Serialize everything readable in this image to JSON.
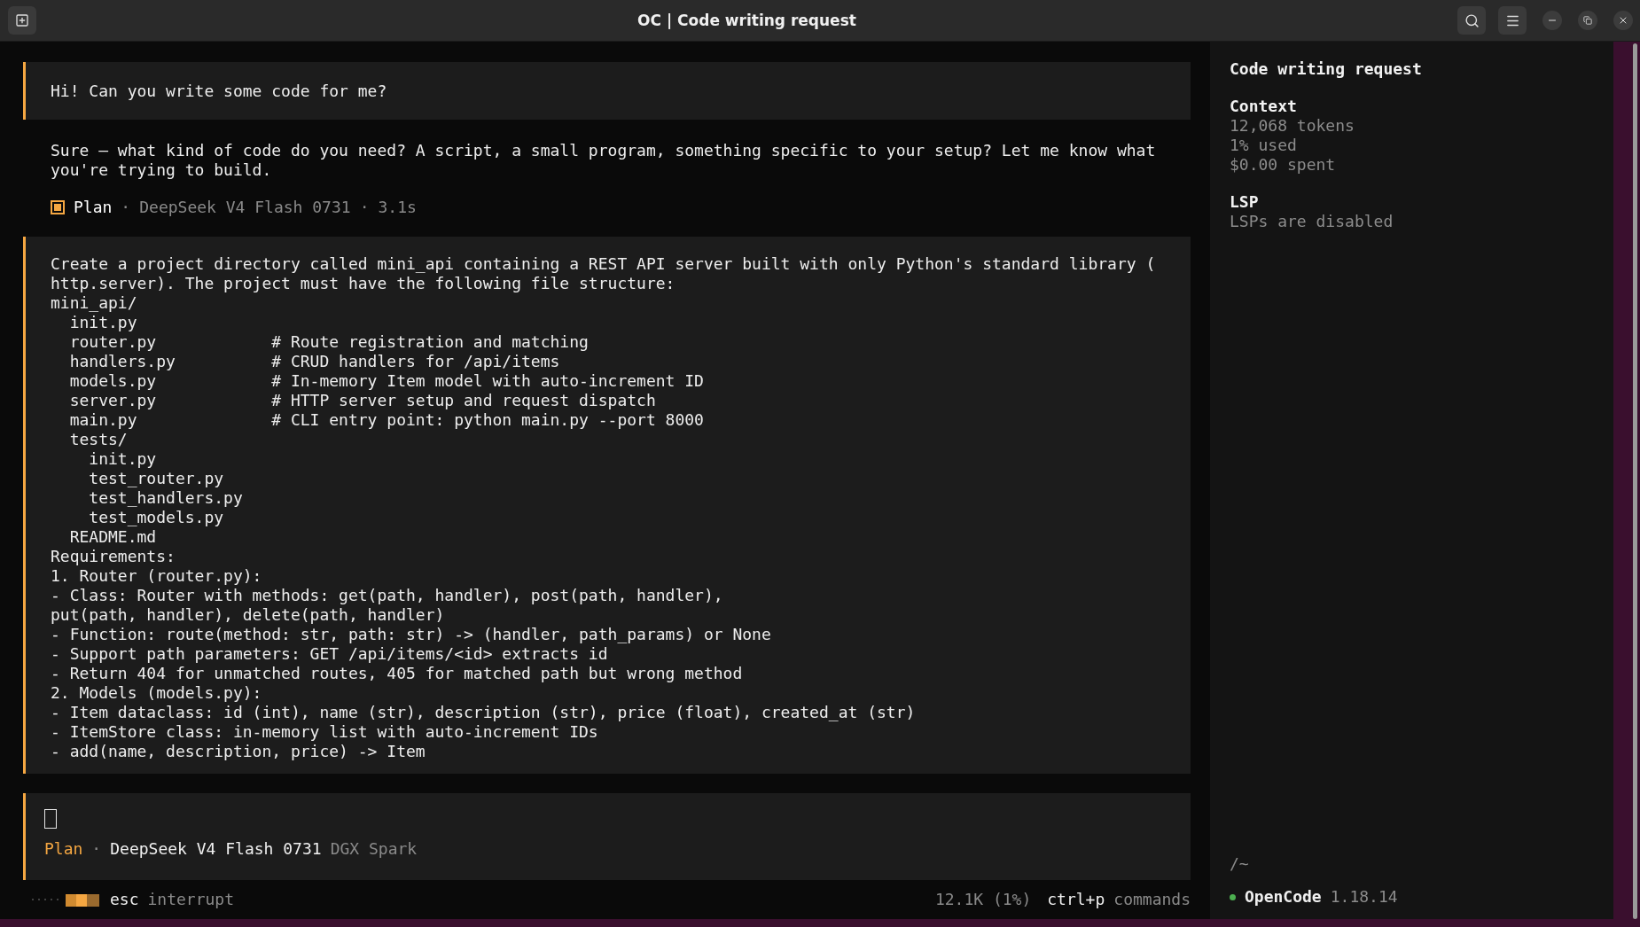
{
  "window": {
    "title": "OC | Code writing request"
  },
  "messages": [
    {
      "kind": "user",
      "lines": [
        "Hi! Can you write some code for me?"
      ]
    },
    {
      "kind": "assistant",
      "lines": [
        "Sure — what kind of code do you need? A script, a small program, something specific to your setup? Let me know what",
        "you're trying to build."
      ],
      "meta": [
        {
          "kind": "agent",
          "text": "Plan"
        },
        {
          "kind": "dim",
          "text": "·"
        },
        {
          "kind": "dim",
          "text": "DeepSeek V4 Flash 0731"
        },
        {
          "kind": "dim",
          "text": "·"
        },
        {
          "kind": "dim",
          "text": "3.1s"
        }
      ]
    },
    {
      "kind": "user",
      "lines": [
        "Create a project directory called mini_api containing a REST API server built with only Python's standard library (",
        "http.server). The project must have the following file structure:",
        "mini_api/",
        "  init.py",
        "  router.py            # Route registration and matching",
        "  handlers.py          # CRUD handlers for /api/items",
        "  models.py            # In-memory Item model with auto-increment ID",
        "  server.py            # HTTP server setup and request dispatch",
        "  main.py              # CLI entry point: python main.py --port 8000",
        "  tests/",
        "    init.py",
        "    test_router.py",
        "    test_handlers.py",
        "    test_models.py",
        "  README.md",
        "Requirements:",
        "1. Router (router.py):",
        "- Class: Router with methods: get(path, handler), post(path, handler),",
        "put(path, handler), delete(path, handler)",
        "- Function: route(method: str, path: str) -> (handler, path_params) or None",
        "- Support path parameters: GET /api/items/<id> extracts id",
        "- Return 404 for unmatched routes, 405 for matched path but wrong method",
        "2. Models (models.py):",
        "- Item dataclass: id (int), name (str), description (str), price (float), created_at (str)",
        "- ItemStore class: in-memory list with auto-increment IDs",
        "- add(name, description, price) -> Item"
      ]
    }
  ],
  "prompt": {
    "parts": [
      {
        "kind": "accent",
        "text": "Plan"
      },
      {
        "kind": "dim",
        "text": "·"
      },
      {
        "kind": "bright",
        "text": "DeepSeek V4 Flash 0731"
      },
      {
        "kind": "dim",
        "text": "DGX Spark"
      }
    ]
  },
  "footer": {
    "left": [
      {
        "kind": "bright",
        "text": "esc"
      },
      {
        "kind": "dim",
        "text": "interrupt"
      }
    ],
    "usage": "12.1K (1%)",
    "shortcut": [
      {
        "kind": "bright",
        "text": "ctrl+p"
      },
      {
        "kind": "dim",
        "text": "commands"
      }
    ]
  },
  "sidebar": {
    "title": "Code writing request",
    "sections": [
      {
        "heading": "Context",
        "lines": [
          "12,068 tokens",
          "1% used",
          "$0.00 spent"
        ]
      },
      {
        "heading": "LSP",
        "lines": [
          "LSPs are disabled"
        ]
      }
    ],
    "path": "/~",
    "app": {
      "name": "OpenCode",
      "version": "1.18.14",
      "color": "#4caf50"
    }
  }
}
